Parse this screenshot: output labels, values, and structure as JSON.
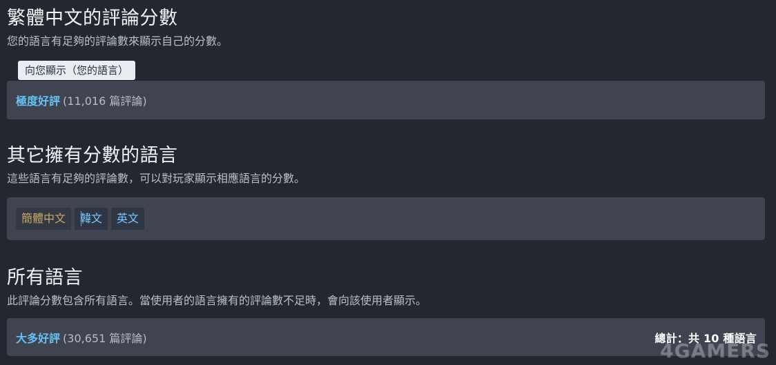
{
  "sections": {
    "traditional": {
      "title": "繁體中文的評論分數",
      "description": "您的語言有足夠的評論數來顯示自己的分數。",
      "badge": "向您顯示（您的語言）",
      "rating": "極度好評",
      "count": "(11,016 篇評論)"
    },
    "others": {
      "title": "其它擁有分數的語言",
      "description": "這些語言有足夠的評論數，可以對玩家顯示相應語言的分數。",
      "chips": [
        "簡體中文",
        "韓文",
        "英文"
      ]
    },
    "all": {
      "title": "所有語言",
      "description": "此評論分數包含所有語言。當使用者的語言擁有的評論數不足時，會向該使用者顯示。",
      "rating": "大多好評",
      "count": "(30,651 篇評論)",
      "total": "總計：共 10 種語言"
    }
  },
  "colors": {
    "background": "#23272f",
    "panel": "#3f4450",
    "rating": "#66c0f4",
    "chip_simplified": "#c6a86c",
    "chip_other": "#7ec7ff"
  },
  "watermark": "4GAMERS"
}
